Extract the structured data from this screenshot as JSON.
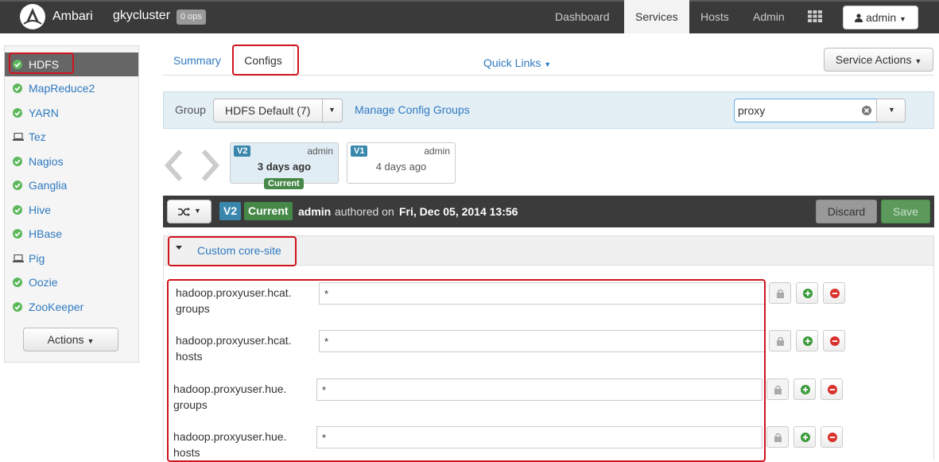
{
  "topnav": {
    "brand": "Ambari",
    "cluster": "gkycluster",
    "ops_badge": "0 ops",
    "links": [
      "Dashboard",
      "Services",
      "Hosts",
      "Admin"
    ],
    "user_label": "admin"
  },
  "sidebar": {
    "items": [
      {
        "label": "HDFS",
        "status": "ok"
      },
      {
        "label": "MapReduce2",
        "status": "ok"
      },
      {
        "label": "YARN",
        "status": "ok"
      },
      {
        "label": "Tez",
        "status": "client"
      },
      {
        "label": "Nagios",
        "status": "ok"
      },
      {
        "label": "Ganglia",
        "status": "ok"
      },
      {
        "label": "Hive",
        "status": "ok"
      },
      {
        "label": "HBase",
        "status": "ok"
      },
      {
        "label": "Pig",
        "status": "client"
      },
      {
        "label": "Oozie",
        "status": "ok"
      },
      {
        "label": "ZooKeeper",
        "status": "ok"
      }
    ],
    "actions_label": "Actions"
  },
  "tabs": {
    "summary": "Summary",
    "configs": "Configs",
    "quick_links": "Quick Links",
    "service_actions": "Service Actions"
  },
  "group_bar": {
    "label": "Group",
    "selected": "HDFS Default (7)",
    "manage": "Manage Config Groups",
    "filter_value": "proxy"
  },
  "versions": [
    {
      "badge": "V2",
      "author": "admin",
      "date": "3 days ago",
      "current_label": "Current"
    },
    {
      "badge": "V1",
      "author": "admin",
      "date": "4 days ago"
    }
  ],
  "version_bar": {
    "badge": "V2",
    "current": "Current",
    "author": "admin",
    "authored_on": "authored on",
    "date": "Fri, Dec 05, 2014 13:56",
    "discard": "Discard",
    "save": "Save"
  },
  "section": {
    "title": "Custom core-site",
    "properties": [
      {
        "line1": "hadoop.proxyuser.hcat.",
        "line2": "groups",
        "value": "*"
      },
      {
        "line1": "hadoop.proxyuser.hcat.",
        "line2": "hosts",
        "value": "*"
      },
      {
        "line1": "hadoop.proxyuser.hue.",
        "line2": "groups",
        "value": "*"
      },
      {
        "line1": "hadoop.proxyuser.hue.",
        "line2": "hosts",
        "value": "*"
      }
    ]
  },
  "colors": {
    "link": "#2f7ac0",
    "ok": "#5cb85c",
    "annotation": "#d0141e",
    "v_badge": "#3a87ad",
    "current_badge": "#468847"
  }
}
